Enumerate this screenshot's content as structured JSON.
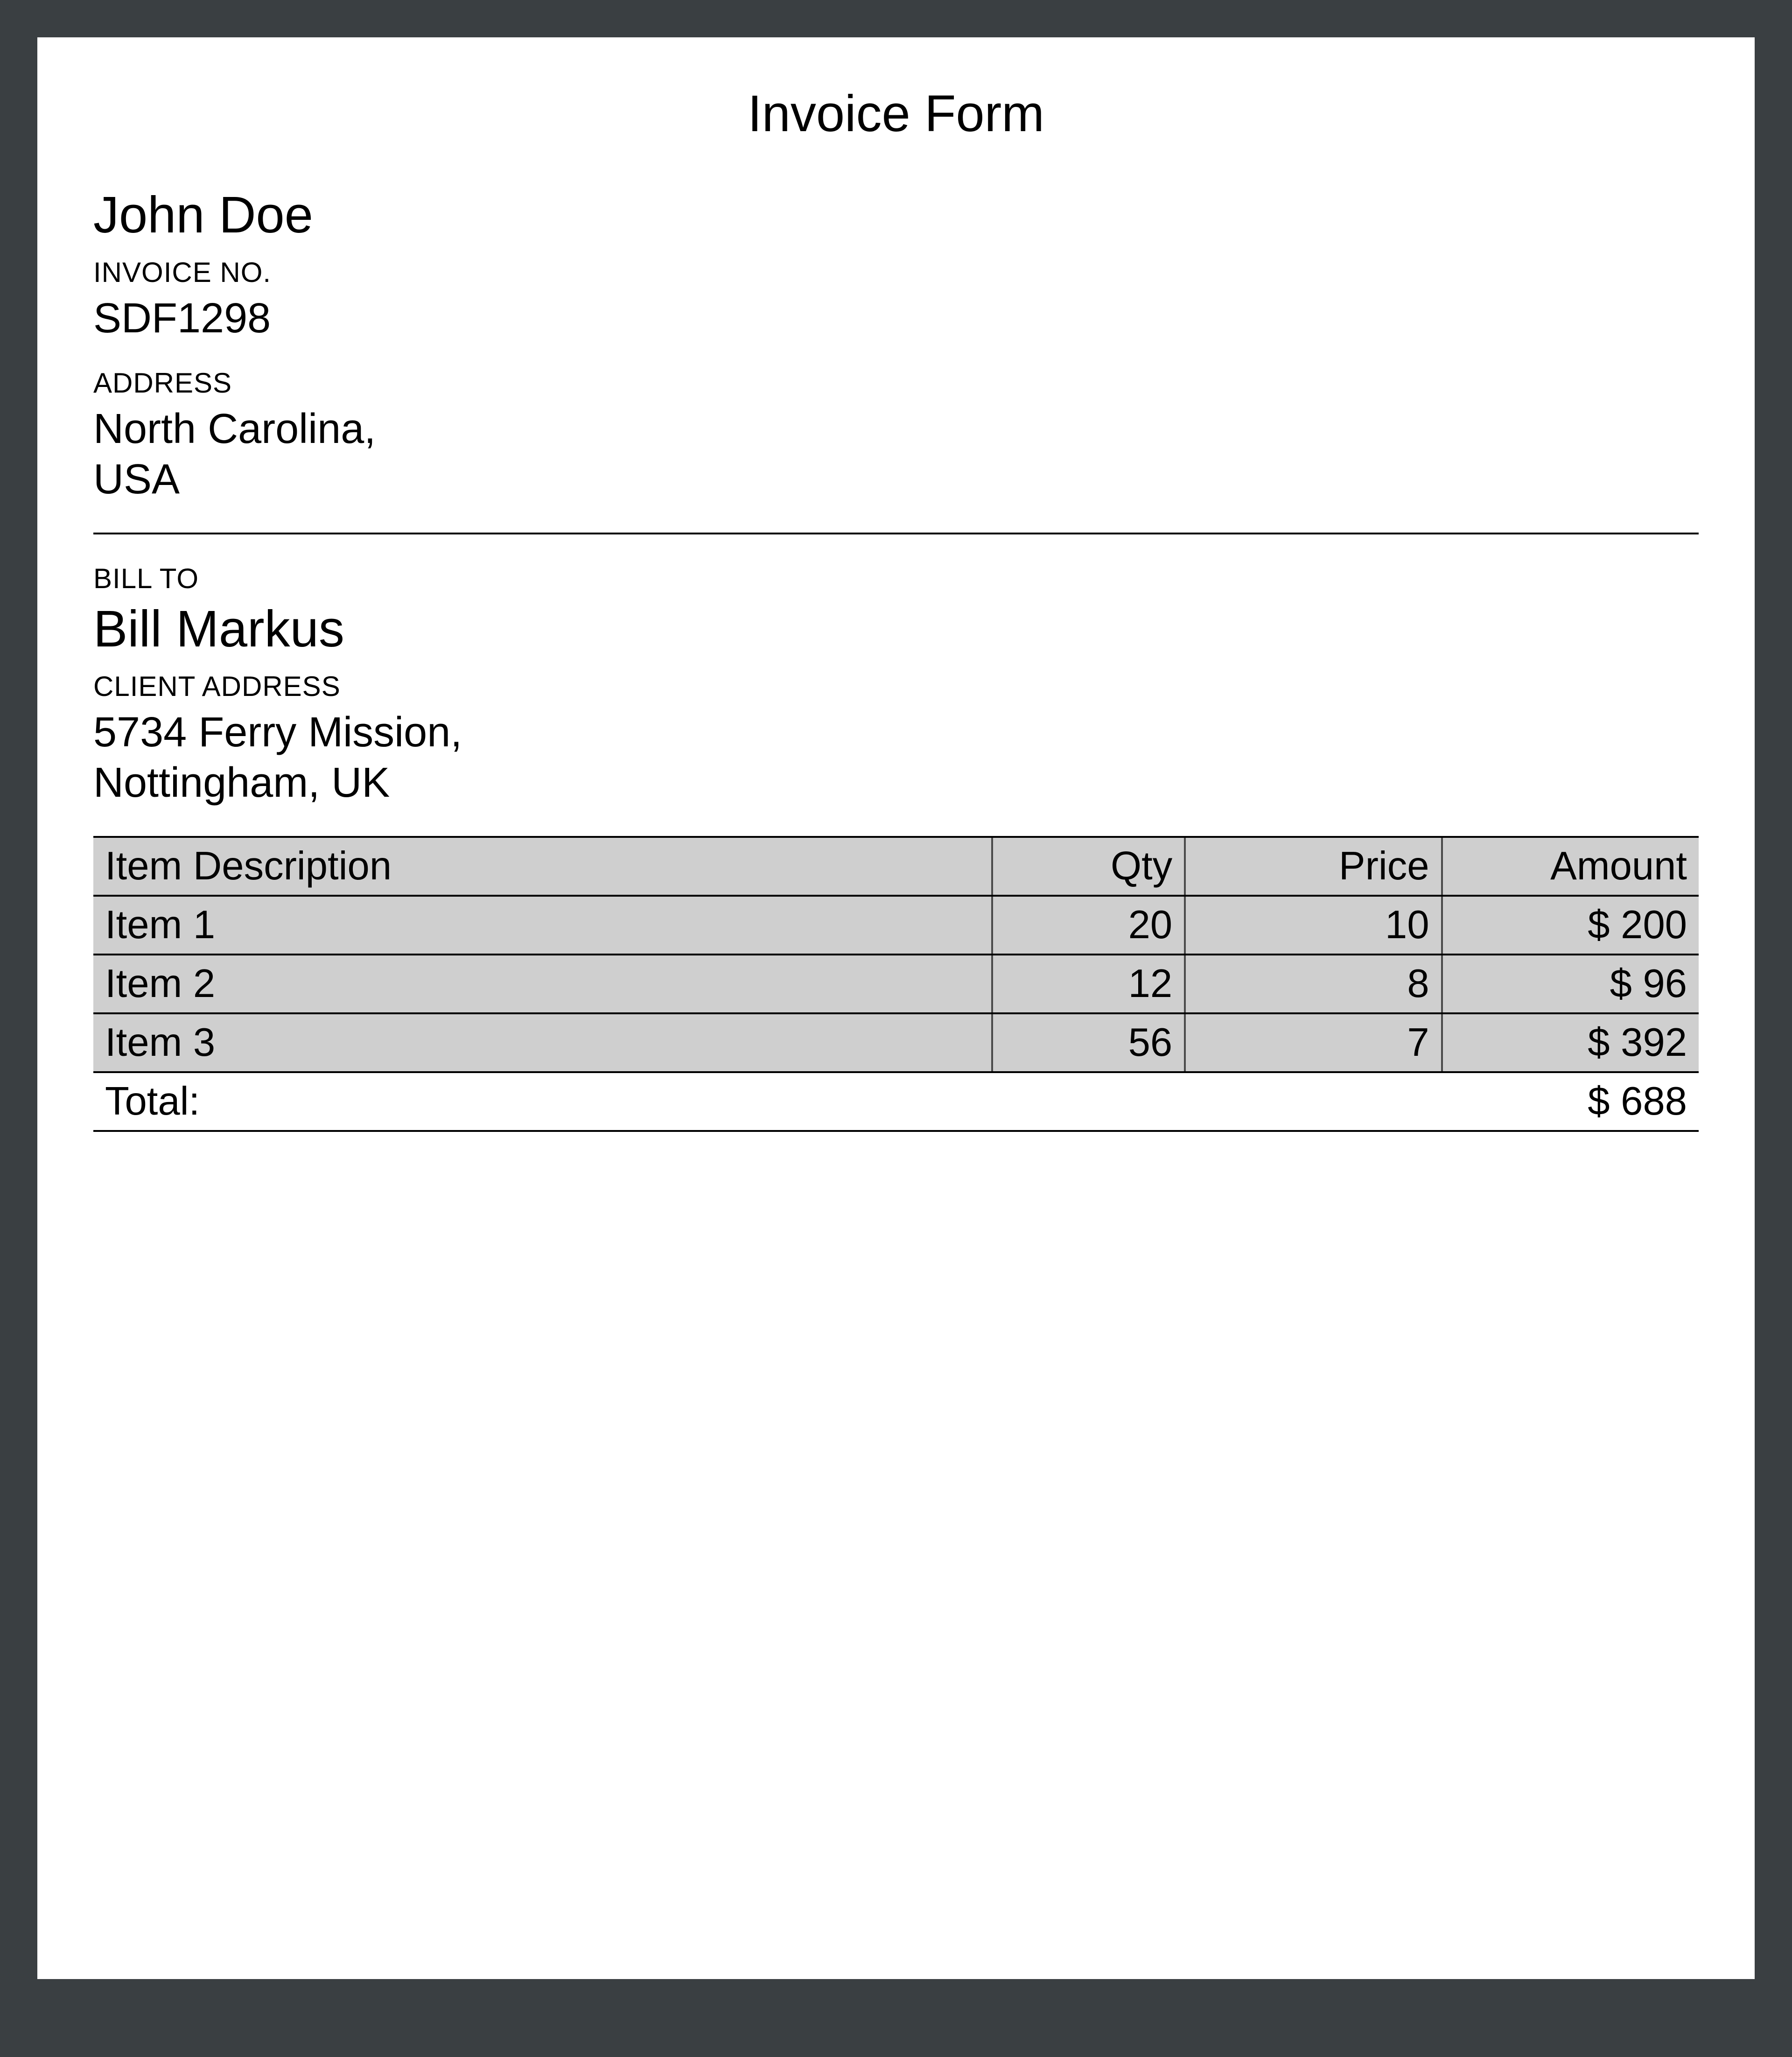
{
  "title": "Invoice Form",
  "sender": {
    "name": "John Doe",
    "invoice_no_label": "INVOICE NO.",
    "invoice_no": "SDF1298",
    "address_label": "ADDRESS",
    "address": "North Carolina,\nUSA"
  },
  "billto": {
    "label": "BILL TO",
    "name": "Bill Markus",
    "client_address_label": "CLIENT ADDRESS",
    "client_address": "5734 Ferry Mission,\nNottingham, UK"
  },
  "table": {
    "headers": {
      "description": "Item Description",
      "qty": "Qty",
      "price": "Price",
      "amount": "Amount"
    },
    "rows": [
      {
        "description": "Item 1",
        "qty": "20",
        "price": "10",
        "amount": "$ 200"
      },
      {
        "description": "Item 2",
        "qty": "12",
        "price": "8",
        "amount": "$ 96"
      },
      {
        "description": "Item 3",
        "qty": "56",
        "price": "7",
        "amount": "$ 392"
      }
    ],
    "total_label": "Total:",
    "total_amount": "$ 688"
  }
}
